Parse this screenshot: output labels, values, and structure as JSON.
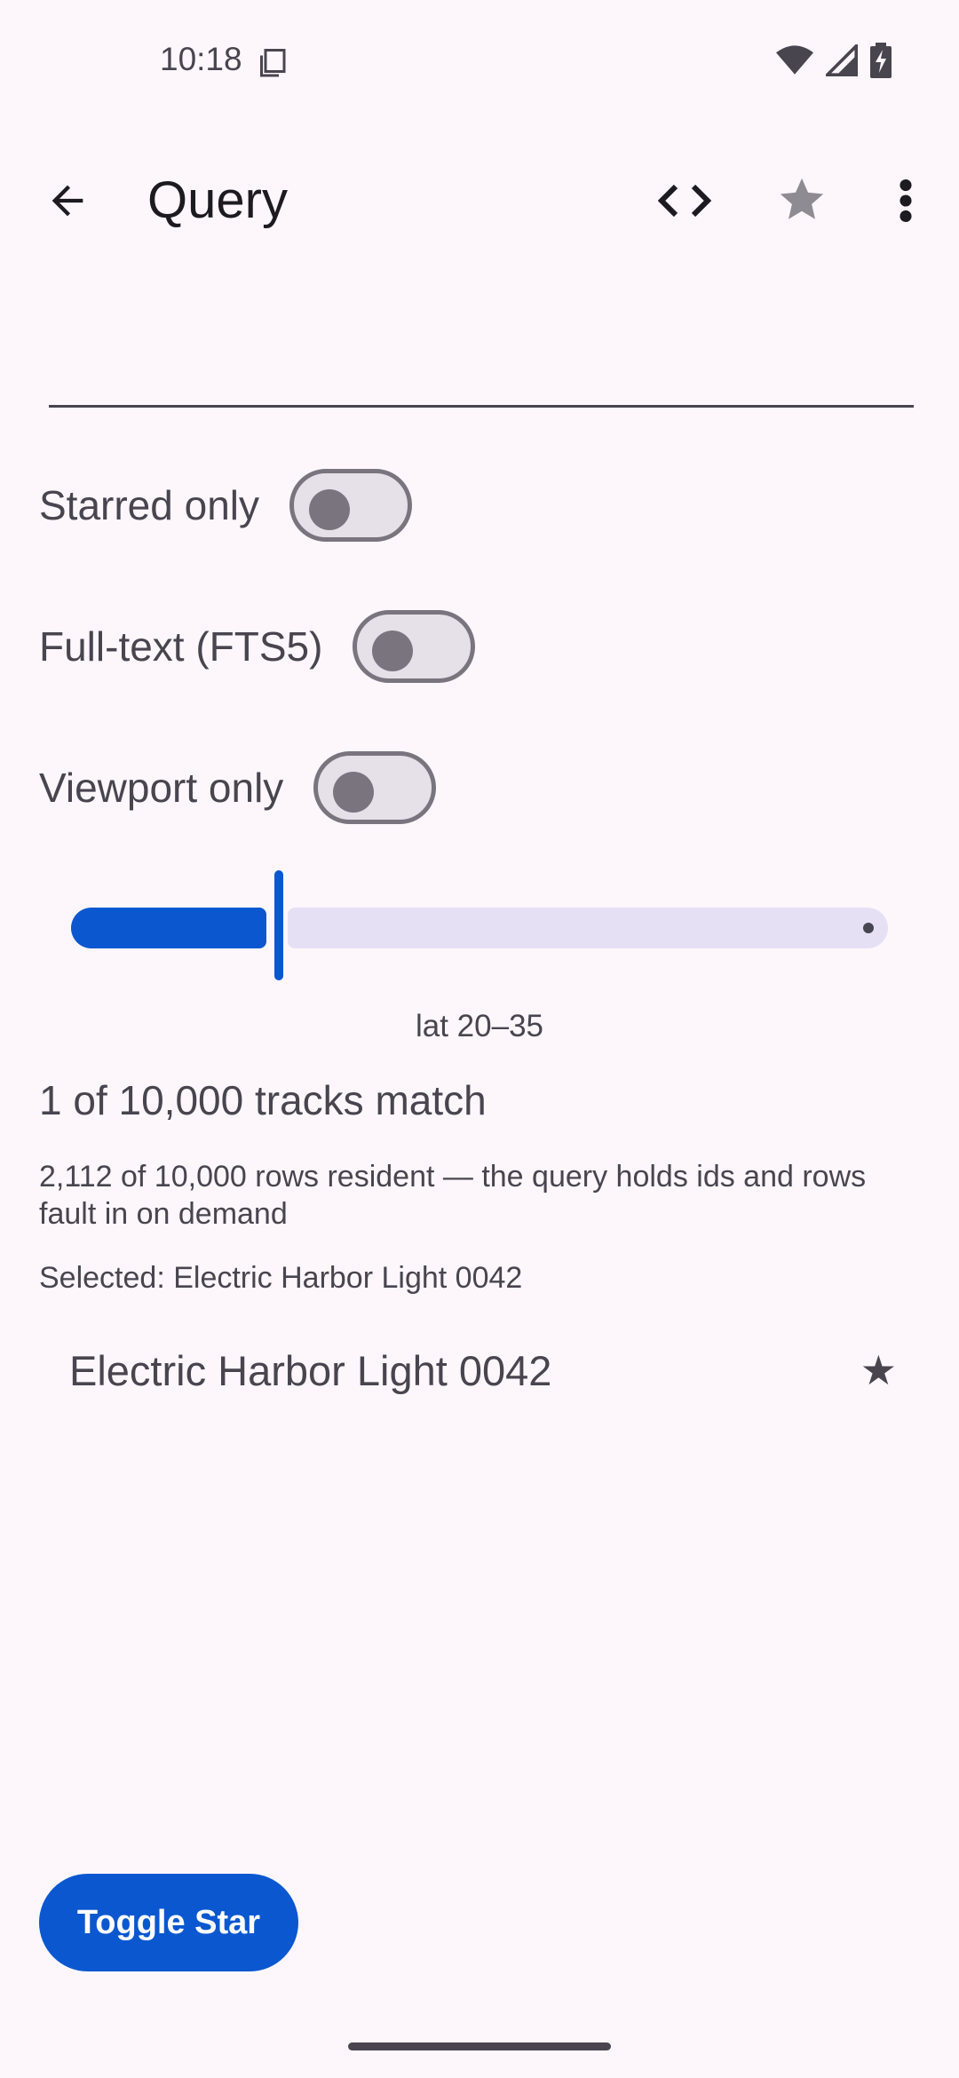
{
  "status_bar": {
    "time": "10:18",
    "icons": [
      "clipboard-icon",
      "wifi-icon",
      "signal-icon",
      "battery-charging-icon"
    ]
  },
  "app_bar": {
    "title": "Query",
    "back_icon": "arrow-back-icon",
    "code_icon": "code-icon",
    "star_icon": "star-icon",
    "more_icon": "more-vert-icon"
  },
  "query_input": {
    "value": "",
    "placeholder": ""
  },
  "switches": {
    "starred_only": {
      "label": "Starred only",
      "checked": false
    },
    "full_text": {
      "label": "Full-text (FTS5)",
      "checked": false
    },
    "viewport_only": {
      "label": "Viewport only",
      "checked": false
    }
  },
  "slider": {
    "value_fraction": 0.25
  },
  "range_label": "lat 20–35",
  "match_count": "1 of 10,000 tracks match",
  "resident_text": "2,112 of 10,000 rows resident — the query holds ids and rows fault in on demand",
  "selected_text": "Selected: Electric Harbor Light 0042",
  "results": [
    {
      "name": "Electric Harbor Light 0042",
      "star": "★"
    }
  ],
  "fab_label": "Toggle Star",
  "colors": {
    "primary": "#0b57d0",
    "background": "#fdf7fc",
    "on_surface_variant": "#49454f",
    "outline": "#79747e"
  }
}
